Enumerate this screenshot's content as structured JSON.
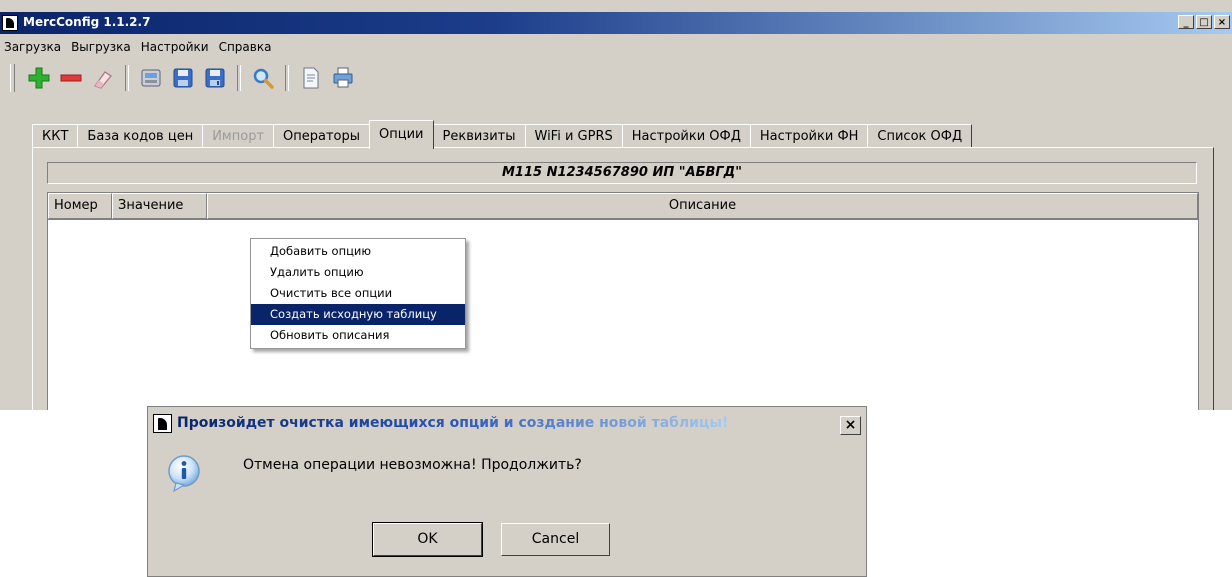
{
  "window": {
    "title": "MercConfig 1.1.2.7",
    "min": "_",
    "max": "□",
    "close": "×"
  },
  "menu": [
    "Загрузка",
    "Выгрузка",
    "Настройки",
    "Справка"
  ],
  "toolbar": {
    "icons": [
      "add-icon",
      "remove-icon",
      "eraser-icon",
      "device-icon",
      "save-icon",
      "save-as-icon",
      "search-icon",
      "document-icon",
      "print-icon"
    ],
    "colors": {
      "add": "#2fb12f",
      "remove": "#e03a3a",
      "accent": "#3a6fc4"
    }
  },
  "tabs": [
    {
      "label": "ККТ",
      "state": "normal"
    },
    {
      "label": "База кодов цен",
      "state": "normal"
    },
    {
      "label": "Импорт",
      "state": "disabled"
    },
    {
      "label": "Операторы",
      "state": "normal"
    },
    {
      "label": "Опции",
      "state": "active"
    },
    {
      "label": "Реквизиты",
      "state": "normal"
    },
    {
      "label": "WiFi и GPRS",
      "state": "normal"
    },
    {
      "label": "Настройки ОФД",
      "state": "normal"
    },
    {
      "label": "Настройки ФН",
      "state": "normal"
    },
    {
      "label": "Список  ОФД",
      "state": "normal"
    }
  ],
  "device_info": "M115 N1234567890 ИП \"АБВГД\"",
  "table": {
    "columns": [
      "Номер",
      "Значение",
      "Описание"
    ],
    "rows": []
  },
  "context_menu": {
    "items": [
      "Добавить опцию",
      "Удалить опцию",
      "Очистить все опции",
      "Создать исходную таблицу",
      "Обновить описания"
    ],
    "highlighted_index": 3
  },
  "dialog": {
    "title": "Произойдет очистка имеющихся опций и создание новой таблицы!",
    "message": "Отмена операции невозможна! Продолжить?",
    "ok_label": "OK",
    "cancel_label": "Cancel",
    "close": "×",
    "icon": "info-icon"
  }
}
